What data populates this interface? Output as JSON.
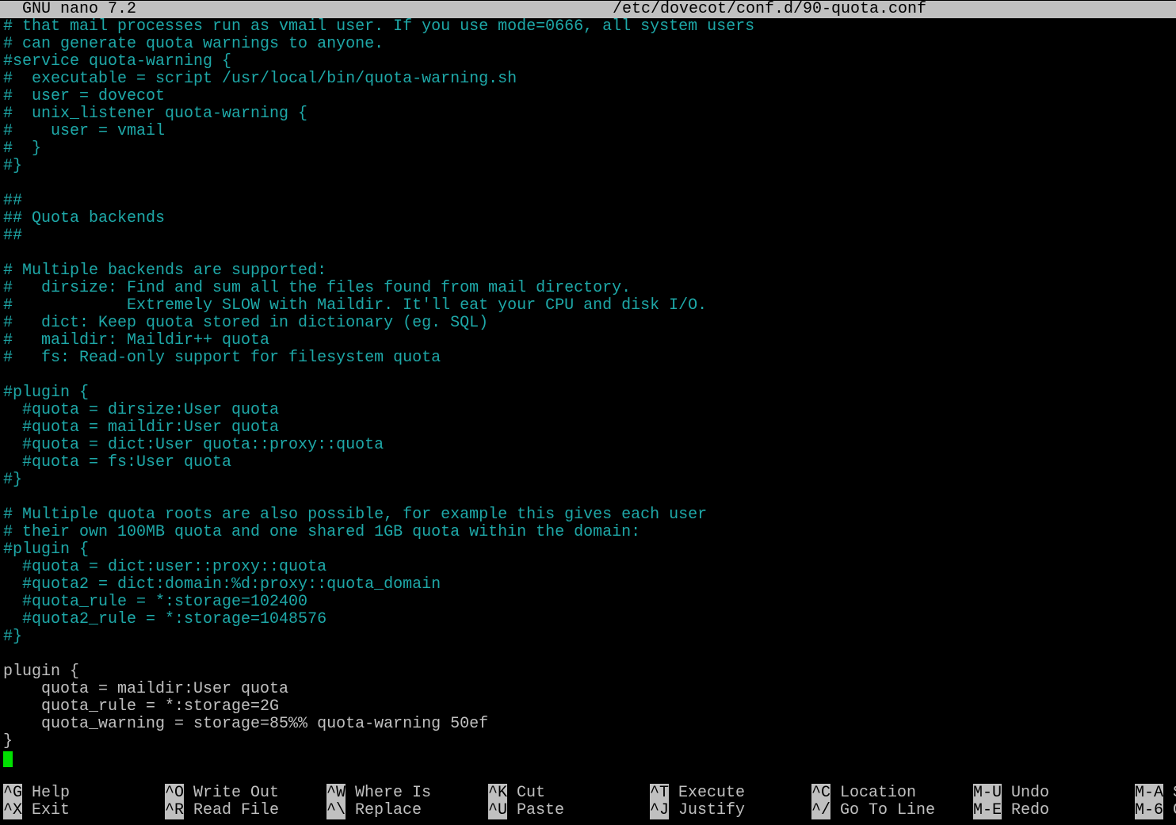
{
  "title_bar": {
    "app": "GNU nano 7.2",
    "filename": "/etc/dovecot/conf.d/90-quota.conf"
  },
  "editor": {
    "lines": [
      {
        "text": "# that mail processes run as vmail user. If you use mode=0666, all system users",
        "type": "comment"
      },
      {
        "text": "# can generate quota warnings to anyone.",
        "type": "comment"
      },
      {
        "text": "#service quota-warning {",
        "type": "comment"
      },
      {
        "text": "#  executable = script /usr/local/bin/quota-warning.sh",
        "type": "comment"
      },
      {
        "text": "#  user = dovecot",
        "type": "comment"
      },
      {
        "text": "#  unix_listener quota-warning {",
        "type": "comment"
      },
      {
        "text": "#    user = vmail",
        "type": "comment"
      },
      {
        "text": "#  }",
        "type": "comment"
      },
      {
        "text": "#}",
        "type": "comment"
      },
      {
        "text": "",
        "type": "normal"
      },
      {
        "text": "##",
        "type": "comment"
      },
      {
        "text": "## Quota backends",
        "type": "comment"
      },
      {
        "text": "##",
        "type": "comment"
      },
      {
        "text": "",
        "type": "normal"
      },
      {
        "text": "# Multiple backends are supported:",
        "type": "comment"
      },
      {
        "text": "#   dirsize: Find and sum all the files found from mail directory.",
        "type": "comment"
      },
      {
        "text": "#            Extremely SLOW with Maildir. It'll eat your CPU and disk I/O.",
        "type": "comment"
      },
      {
        "text": "#   dict: Keep quota stored in dictionary (eg. SQL)",
        "type": "comment"
      },
      {
        "text": "#   maildir: Maildir++ quota",
        "type": "comment"
      },
      {
        "text": "#   fs: Read-only support for filesystem quota",
        "type": "comment"
      },
      {
        "text": "",
        "type": "normal"
      },
      {
        "text": "#plugin {",
        "type": "comment"
      },
      {
        "text": "  #quota = dirsize:User quota",
        "type": "comment"
      },
      {
        "text": "  #quota = maildir:User quota",
        "type": "comment"
      },
      {
        "text": "  #quota = dict:User quota::proxy::quota",
        "type": "comment"
      },
      {
        "text": "  #quota = fs:User quota",
        "type": "comment"
      },
      {
        "text": "#}",
        "type": "comment"
      },
      {
        "text": "",
        "type": "normal"
      },
      {
        "text": "# Multiple quota roots are also possible, for example this gives each user",
        "type": "comment"
      },
      {
        "text": "# their own 100MB quota and one shared 1GB quota within the domain:",
        "type": "comment"
      },
      {
        "text": "#plugin {",
        "type": "comment"
      },
      {
        "text": "  #quota = dict:user::proxy::quota",
        "type": "comment"
      },
      {
        "text": "  #quota2 = dict:domain:%d:proxy::quota_domain",
        "type": "comment"
      },
      {
        "text": "  #quota_rule = *:storage=102400",
        "type": "comment"
      },
      {
        "text": "  #quota2_rule = *:storage=1048576",
        "type": "comment"
      },
      {
        "text": "#}",
        "type": "comment"
      },
      {
        "text": "",
        "type": "normal"
      },
      {
        "text": "plugin {",
        "type": "normal"
      },
      {
        "text": "    quota = maildir:User quota",
        "type": "normal"
      },
      {
        "text": "    quota_rule = *:storage=2G",
        "type": "normal"
      },
      {
        "text": "    quota_warning = storage=85%% quota-warning 50ef",
        "type": "normal"
      },
      {
        "text": "}",
        "type": "normal"
      },
      {
        "text": "",
        "type": "cursor"
      }
    ]
  },
  "shortcuts": [
    {
      "key": "^G",
      "label": "Help"
    },
    {
      "key": "^O",
      "label": "Write Out"
    },
    {
      "key": "^W",
      "label": "Where Is"
    },
    {
      "key": "^K",
      "label": "Cut"
    },
    {
      "key": "^T",
      "label": "Execute"
    },
    {
      "key": "^C",
      "label": "Location"
    },
    {
      "key": "M-U",
      "label": "Undo"
    },
    {
      "key": "M-A",
      "label": "S"
    },
    {
      "key": "^X",
      "label": "Exit"
    },
    {
      "key": "^R",
      "label": "Read File"
    },
    {
      "key": "^\\",
      "label": "Replace"
    },
    {
      "key": "^U",
      "label": "Paste"
    },
    {
      "key": "^J",
      "label": "Justify"
    },
    {
      "key": "^/",
      "label": "Go To Line"
    },
    {
      "key": "M-E",
      "label": "Redo"
    },
    {
      "key": "M-6",
      "label": "C"
    }
  ],
  "colors": {
    "comment": "#1ea8a8",
    "normal": "#c0c0c0",
    "cursor": "#00e000",
    "bar": "#c0c0c0",
    "background": "#000000"
  }
}
